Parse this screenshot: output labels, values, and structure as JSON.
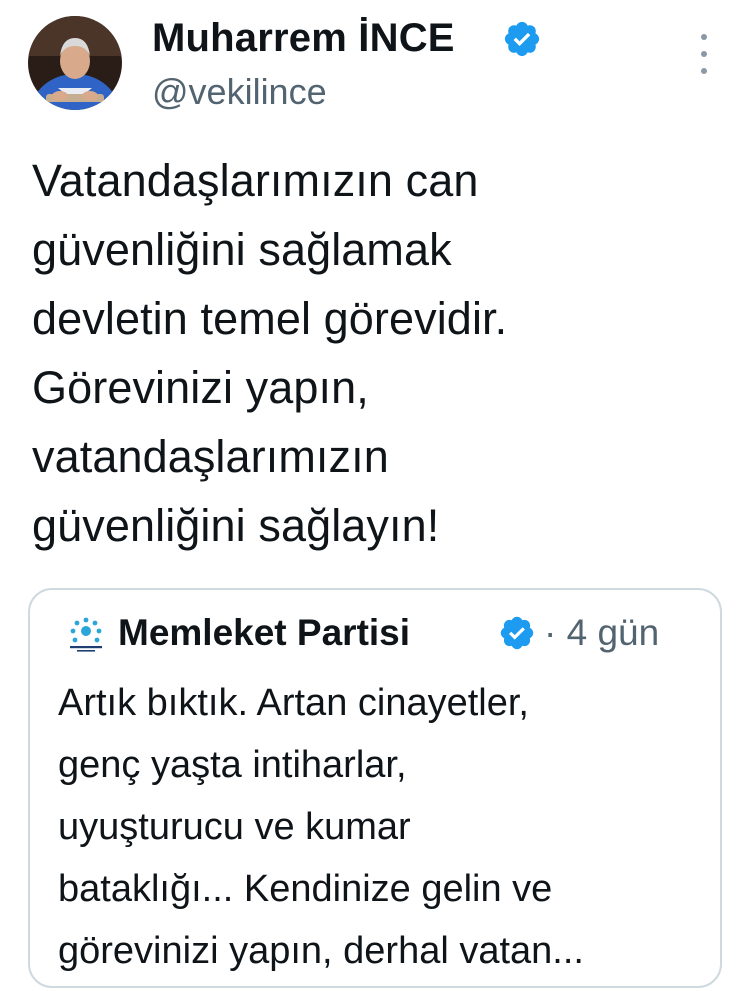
{
  "tweet": {
    "author": {
      "name": "Muharrem İNCE",
      "handle": "@vekilince",
      "verified": true,
      "avatar": "profile-photo"
    },
    "text": "Vatandaşlarımızın can\ngüvenliğini sağlamak\ndevletin temel görevidir.\nGörevinizi yapın,\nvatandaşlarımızın\ngüvenliğini sağlayın!",
    "more_icon": "more-vertical-icon"
  },
  "quote": {
    "author": {
      "name": "Memleket Partisi",
      "verified": true,
      "logo": "memleket-partisi-logo"
    },
    "separator": "·",
    "age": "4 gün",
    "text": "Artık bıktık. Artan cinayetler,\ngenç yaşta intiharlar,\nuyuşturucu ve kumar\nbataklığı... Kendinize gelin ve\ngörevinizi yapın, derhal vatan..."
  },
  "colors": {
    "text": "#0f1419",
    "secondary": "#536471",
    "verified": "#1d9bf0",
    "border": "#cfd9de"
  }
}
